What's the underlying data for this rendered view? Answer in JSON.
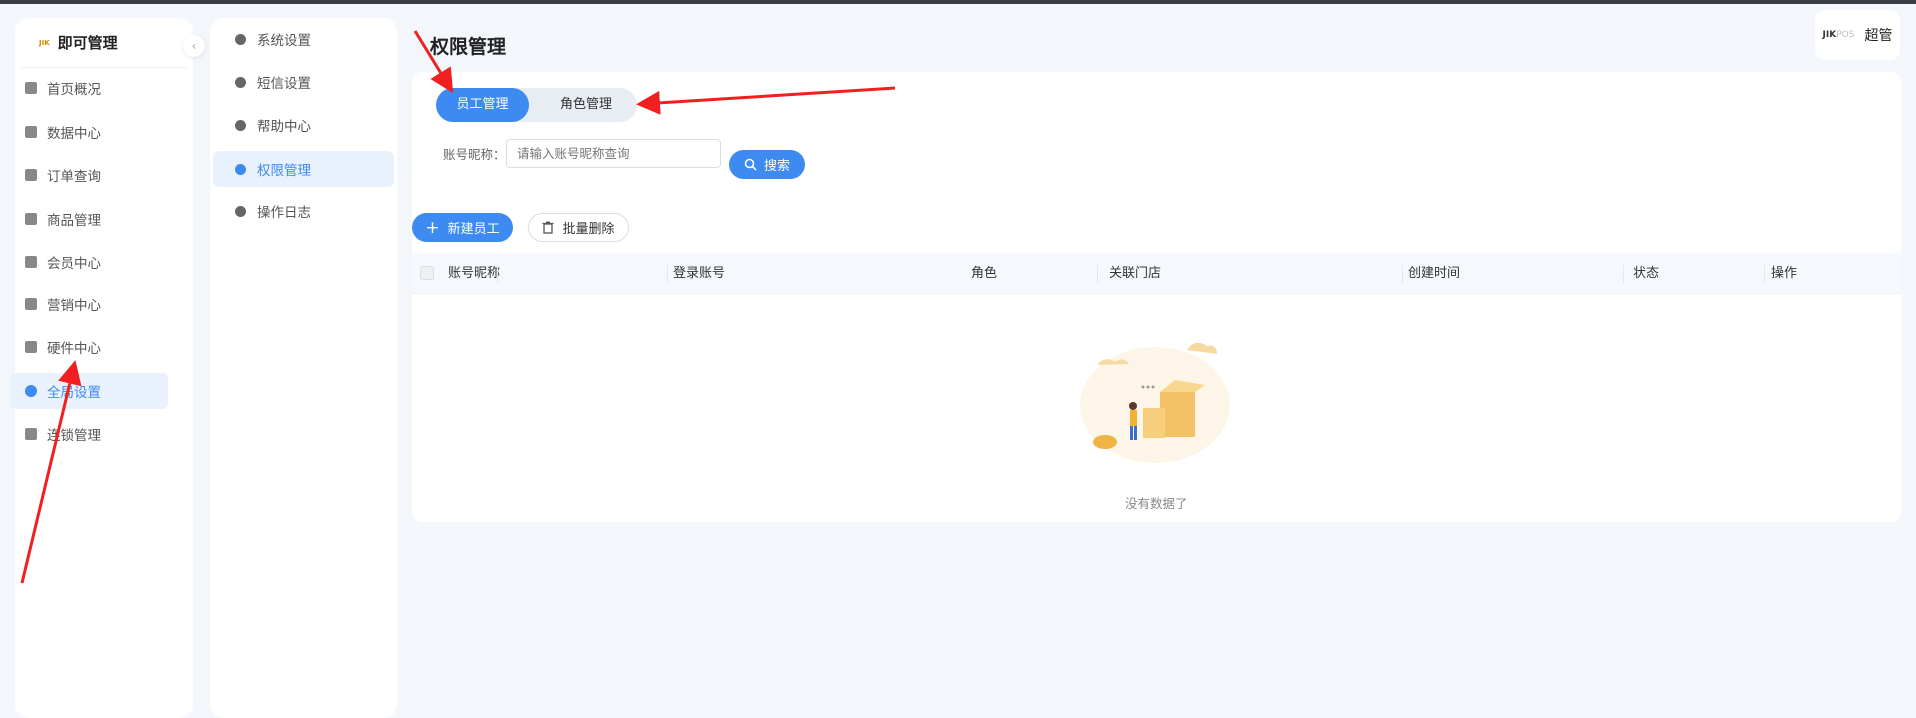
{
  "brand": {
    "logo_text": "JIKPOS",
    "name": "即可管理"
  },
  "sidebar": {
    "items": [
      {
        "label": "首页概况",
        "icon": "grid-icon"
      },
      {
        "label": "数据中心",
        "icon": "bar-chart-icon"
      },
      {
        "label": "订单查询",
        "icon": "calendar-icon"
      },
      {
        "label": "商品管理",
        "icon": "bag-icon"
      },
      {
        "label": "会员中心",
        "icon": "crown-icon"
      },
      {
        "label": "营销中心",
        "icon": "coupon-icon"
      },
      {
        "label": "硬件中心",
        "icon": "hardware-icon"
      },
      {
        "label": "全局设置",
        "icon": "gear-icon",
        "active": true
      },
      {
        "label": "连锁管理",
        "icon": "shield-icon"
      }
    ]
  },
  "submenu": {
    "items": [
      {
        "label": "系统设置",
        "icon": "gear-icon"
      },
      {
        "label": "短信设置",
        "icon": "gear-icon"
      },
      {
        "label": "帮助中心",
        "icon": "info-icon"
      },
      {
        "label": "权限管理",
        "icon": "shield-icon",
        "active": true
      },
      {
        "label": "操作日志",
        "icon": "clipboard-icon"
      }
    ]
  },
  "header": {
    "title": "权限管理",
    "user_logo": "JIKPOS",
    "user_role": "超管"
  },
  "tabs": [
    {
      "label": "员工管理",
      "active": true
    },
    {
      "label": "角色管理",
      "active": false
    }
  ],
  "search": {
    "label": "账号昵称：",
    "placeholder": "请输入账号昵称查询",
    "button": "搜索"
  },
  "actions": {
    "new": "新建员工",
    "batch_delete": "批量删除"
  },
  "table": {
    "columns": [
      "账号昵称",
      "登录账号",
      "角色",
      "关联门店",
      "创建时间",
      "状态",
      "操作"
    ],
    "rows": [],
    "empty_text": "没有数据了"
  },
  "colors": {
    "accent": "#3d8af0",
    "annotation": "#f02020"
  }
}
